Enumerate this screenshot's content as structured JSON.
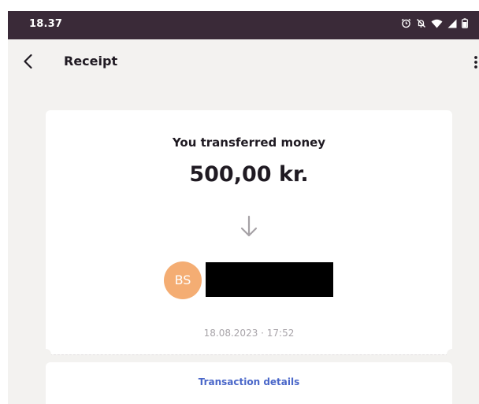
{
  "status_bar": {
    "time": "18.37",
    "icons": [
      "alarm-icon",
      "notifications-off-icon",
      "wifi-icon",
      "signal-icon",
      "battery-icon"
    ]
  },
  "app_bar": {
    "title": "Receipt",
    "back_icon": "chevron-left-icon",
    "menu_icon": "more-vertical-icon"
  },
  "receipt": {
    "title": "You transferred money",
    "amount": "500,00 kr.",
    "direction_icon": "arrow-down-icon",
    "recipient_initials": "BS",
    "timestamp": "18.08.2023 · 17:52",
    "details_link": "Transaction details"
  },
  "colors": {
    "status_bar": "#3a2a38",
    "background": "#f3f2f0",
    "avatar": "#f4ad73",
    "link": "#4a67c9"
  }
}
